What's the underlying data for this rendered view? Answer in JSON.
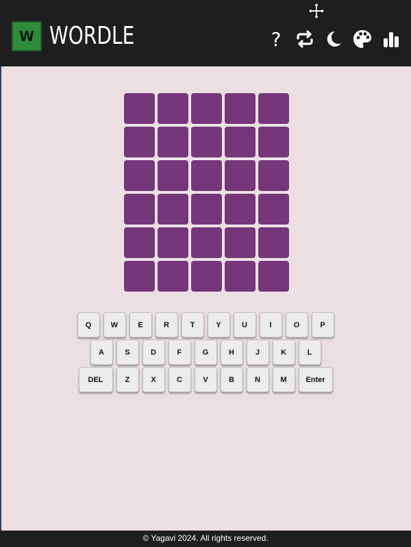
{
  "header": {
    "logo_letter": "W",
    "title": "WORDLE",
    "help_label": "?",
    "icons": [
      "question-icon",
      "repeat-icon",
      "moon-icon",
      "palette-icon",
      "bar-chart-icon"
    ]
  },
  "colors": {
    "header_bg": "#1e1e20",
    "page_bg": "#ebdfe1",
    "tile": "#75377a",
    "logo": "#2e8b3a",
    "key_bg": "#ececec"
  },
  "board": {
    "rows": 6,
    "cols": 5
  },
  "keyboard": {
    "rows": [
      [
        "Q",
        "W",
        "E",
        "R",
        "T",
        "Y",
        "U",
        "I",
        "O",
        "P"
      ],
      [
        "A",
        "S",
        "D",
        "F",
        "G",
        "H",
        "J",
        "K",
        "L"
      ],
      [
        "DEL",
        "Z",
        "X",
        "C",
        "V",
        "B",
        "N",
        "M",
        "Enter"
      ]
    ]
  },
  "footer": {
    "text": "© Yagavi 2024. All rights reserved."
  }
}
